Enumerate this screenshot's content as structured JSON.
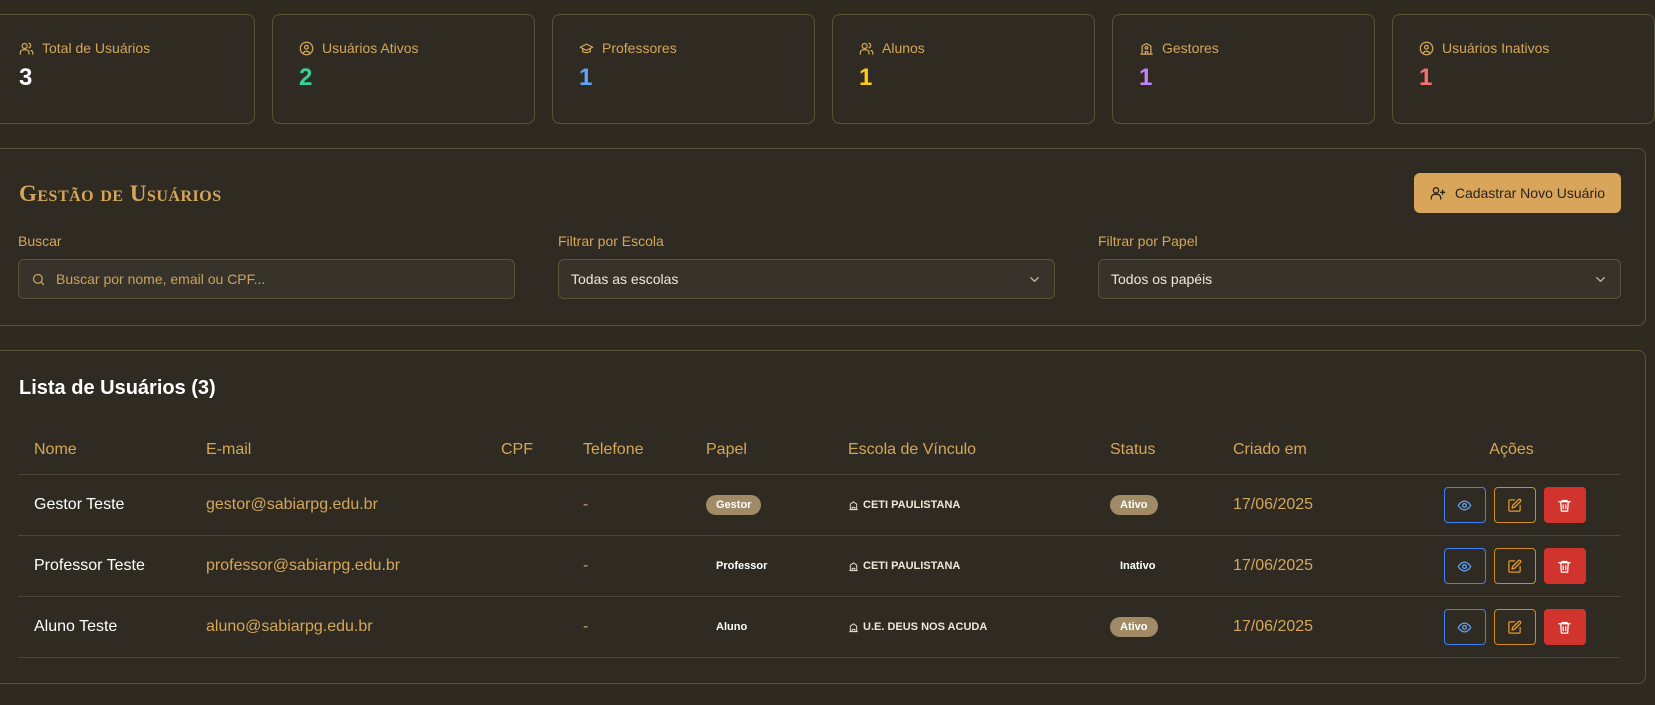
{
  "stats": [
    {
      "label": "Total de Usuários",
      "value": "3",
      "icon": "users-icon",
      "color": "#ffffff"
    },
    {
      "label": "Usuários Ativos",
      "value": "2",
      "icon": "user-circle-icon",
      "color": "#34d399"
    },
    {
      "label": "Professores",
      "value": "1",
      "icon": "graduation-cap-icon",
      "color": "#60a5fa"
    },
    {
      "label": "Alunos",
      "value": "1",
      "icon": "users-icon",
      "color": "#facc15"
    },
    {
      "label": "Gestores",
      "value": "1",
      "icon": "building-icon",
      "color": "#c084fc"
    },
    {
      "label": "Usuários Inativos",
      "value": "1",
      "icon": "user-circle-icon",
      "color": "#f87171"
    }
  ],
  "management": {
    "title": "Gestão de Usuários",
    "new_user_button": "Cadastrar Novo Usuário",
    "search": {
      "label": "Buscar",
      "placeholder": "Buscar por nome, email ou CPF..."
    },
    "school_filter": {
      "label": "Filtrar por Escola",
      "selected": "Todas as escolas"
    },
    "role_filter": {
      "label": "Filtrar por Papel",
      "selected": "Todos os papéis"
    }
  },
  "list": {
    "title": "Lista de Usuários (3)",
    "columns": [
      "Nome",
      "E-mail",
      "CPF",
      "Telefone",
      "Papel",
      "Escola de Vínculo",
      "Status",
      "Criado em",
      "Ações"
    ],
    "rows": [
      {
        "name": "Gestor Teste",
        "email": "gestor@sabiarpg.edu.br",
        "cpf": "",
        "phone": "-",
        "role": "Gestor",
        "school": "CETI PAULISTANA",
        "status": "Ativo",
        "created": "17/06/2025"
      },
      {
        "name": "Professor Teste",
        "email": "professor@sabiarpg.edu.br",
        "cpf": "",
        "phone": "-",
        "role": "Professor",
        "school": "CETI PAULISTANA",
        "status": "Inativo",
        "created": "17/06/2025"
      },
      {
        "name": "Aluno Teste",
        "email": "aluno@sabiarpg.edu.br",
        "cpf": "",
        "phone": "-",
        "role": "Aluno",
        "school": "U.E. DEUS NOS ACUDA",
        "status": "Ativo",
        "created": "17/06/2025"
      }
    ]
  }
}
